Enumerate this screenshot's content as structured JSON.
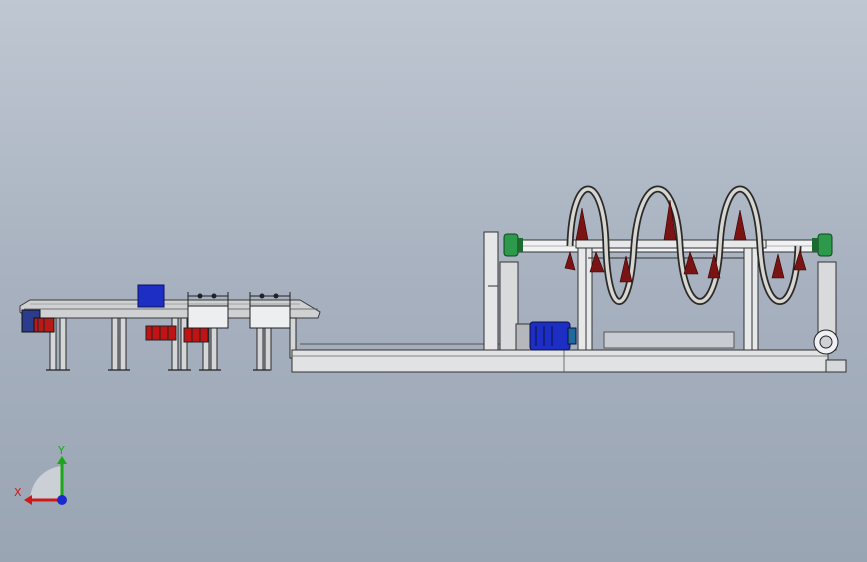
{
  "triad": {
    "x_label": "X",
    "y_label": "Y",
    "x_color": "#d01818",
    "y_color": "#1aa81a",
    "z_color": "#1a2acc"
  },
  "colors": {
    "background_top": "#bfc7d2",
    "background_bottom": "#9aa5b4",
    "frame": "#e2e4e6",
    "frame_dark": "#8e9196",
    "conveyor": "#c4c6c8",
    "drive_red": "#c01414",
    "motor_blue": "#1c2ec4",
    "motor_dark": "#1e6a9a",
    "bearing_green": "#2c9a4a",
    "auger_blade": "#7a1a1a"
  },
  "icons": [
    "conveyor-line",
    "auger-screw",
    "electric-motor",
    "bearing-housing",
    "coordinate-triad-icon"
  ]
}
